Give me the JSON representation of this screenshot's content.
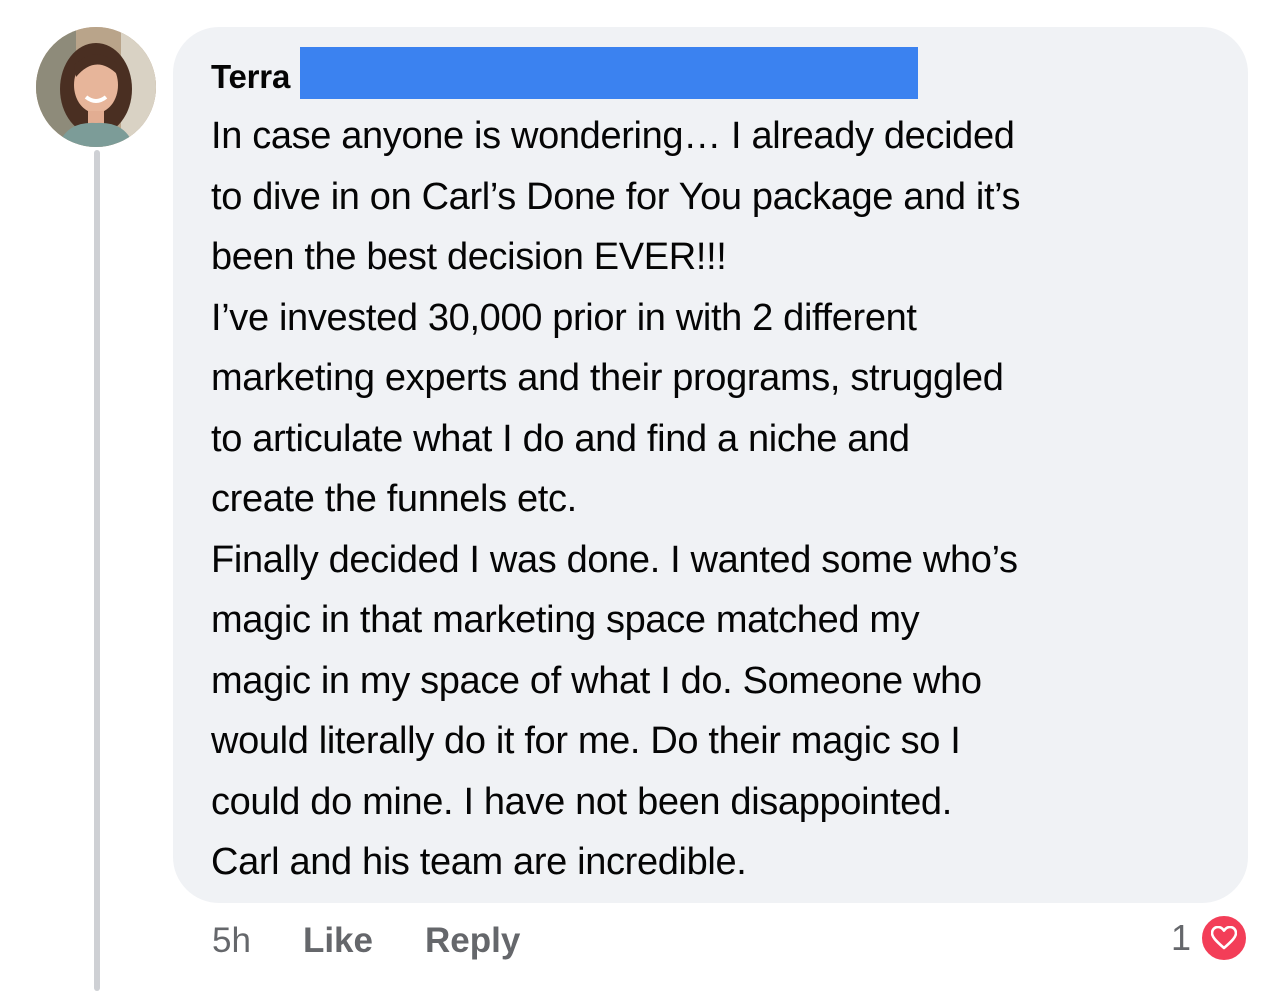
{
  "comment": {
    "author": "Terra",
    "body": "In case anyone is wondering… I already decided\nto dive in on Carl’s Done for You package and it’s\nbeen the best decision EVER!!!\nI’ve invested 30,000 prior in with 2 different\nmarketing experts and their programs, struggled\nto articulate what I do and find a niche and\ncreate the funnels etc.\nFinally decided I was done. I wanted some who’s\nmagic in that marketing space matched my\nmagic in my space of what I do. Someone who\nwould literally do it for me. Do their magic so I\ncould do mine. I have not been disappointed.\nCarl and his team are incredible.",
    "timestamp": "5h",
    "like_label": "Like",
    "reply_label": "Reply",
    "reaction_count": "1",
    "reaction_icon": "heart-icon"
  },
  "colors": {
    "bubble": "#f0f2f5",
    "redaction": "#3b82f0",
    "reaction": "#f33e58",
    "secondary_text": "#65676b"
  }
}
